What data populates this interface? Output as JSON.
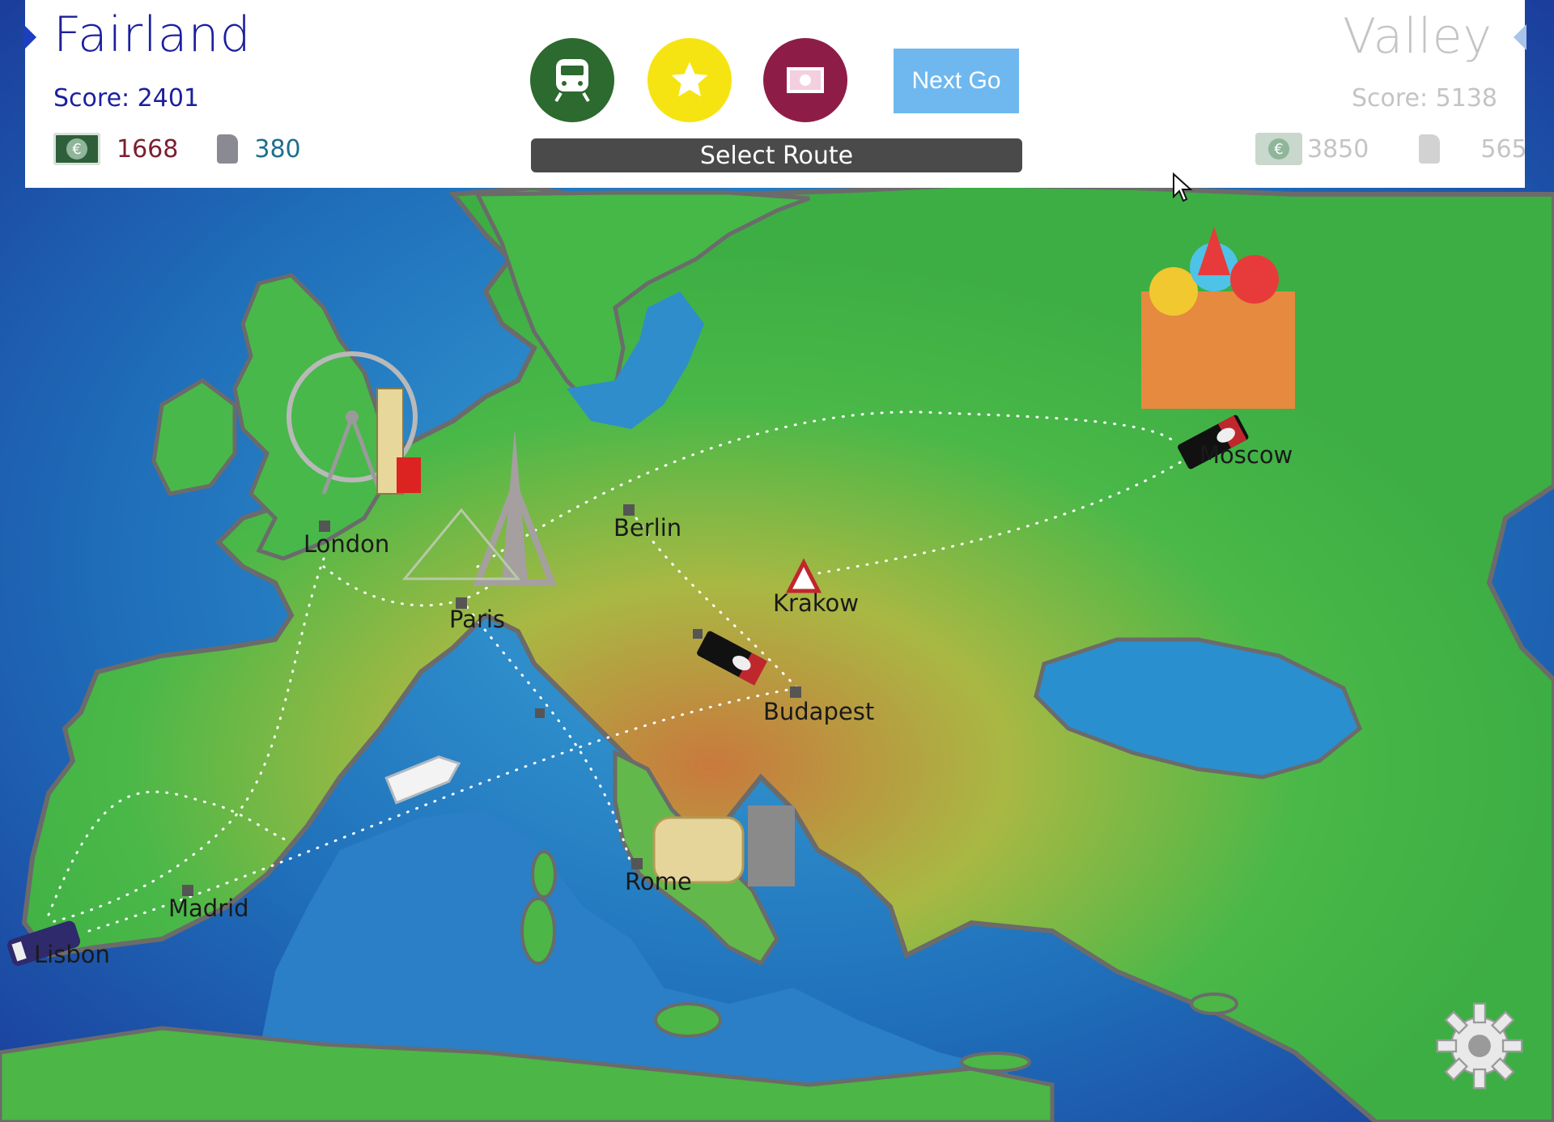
{
  "player1": {
    "name": "Fairland",
    "score": "Score: 2401",
    "money": "1668",
    "fuel": "380",
    "money_symbol": "€"
  },
  "player2": {
    "name": "Valley",
    "score": "Score: 5138",
    "money": "3850",
    "fuel": "565",
    "money_symbol": "€"
  },
  "actions": {
    "train_icon": "train-icon",
    "star_icon": "star-icon",
    "money_icon": "banknote-icon",
    "next_go": "Next Go",
    "select_route": "Select Route"
  },
  "cities": {
    "london": "London",
    "paris": "Paris",
    "berlin": "Berlin",
    "krakow": "Krakow",
    "budapest": "Budapest",
    "rome": "Rome",
    "madrid": "Madrid",
    "lisbon": "Lisbon",
    "moscow": "Moscow"
  },
  "colors": {
    "player1_accent": "#1b1f9e",
    "next_go_button": "#6fb8ef",
    "train_button": "#2d6a2f",
    "star_button": "#f6e412",
    "money_button": "#8d1d47"
  }
}
